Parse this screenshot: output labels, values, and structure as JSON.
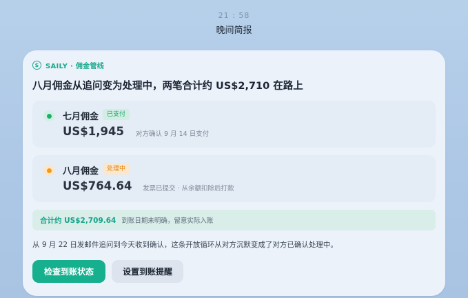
{
  "status_bar": {
    "time": "21 : 58",
    "title": "晚间简报"
  },
  "notification": {
    "app": {
      "icon": "dollar-circle-icon",
      "icon_glyph": "$",
      "name": "SAILY · 佣金管线",
      "accent_color": "#1aa88c"
    },
    "headline": "八月佣金从追问变为处理中，两笔合计约 US$2,710 在路上",
    "items": [
      {
        "title": "七月佣金",
        "status": "已支付",
        "status_color": "#16b26c",
        "amount": "US$1,945",
        "note": "对方确认 9 月 14 日支付"
      },
      {
        "title": "八月佣金",
        "status": "处理中",
        "status_color": "#f39a1b",
        "amount": "US$764.64",
        "note": "发票已提交 · 从余额扣除后打款"
      }
    ],
    "summary": {
      "total": "合计约 US$2,709.64",
      "note": "到账日期未明确，留意实际入账"
    },
    "body": "从 9 月 22 日发邮件追问到今天收到确认，这条开放循环从对方沉默变成了对方已确认处理中。",
    "actions": {
      "primary": "检查到账状态",
      "secondary": "设置到账提醒"
    }
  }
}
